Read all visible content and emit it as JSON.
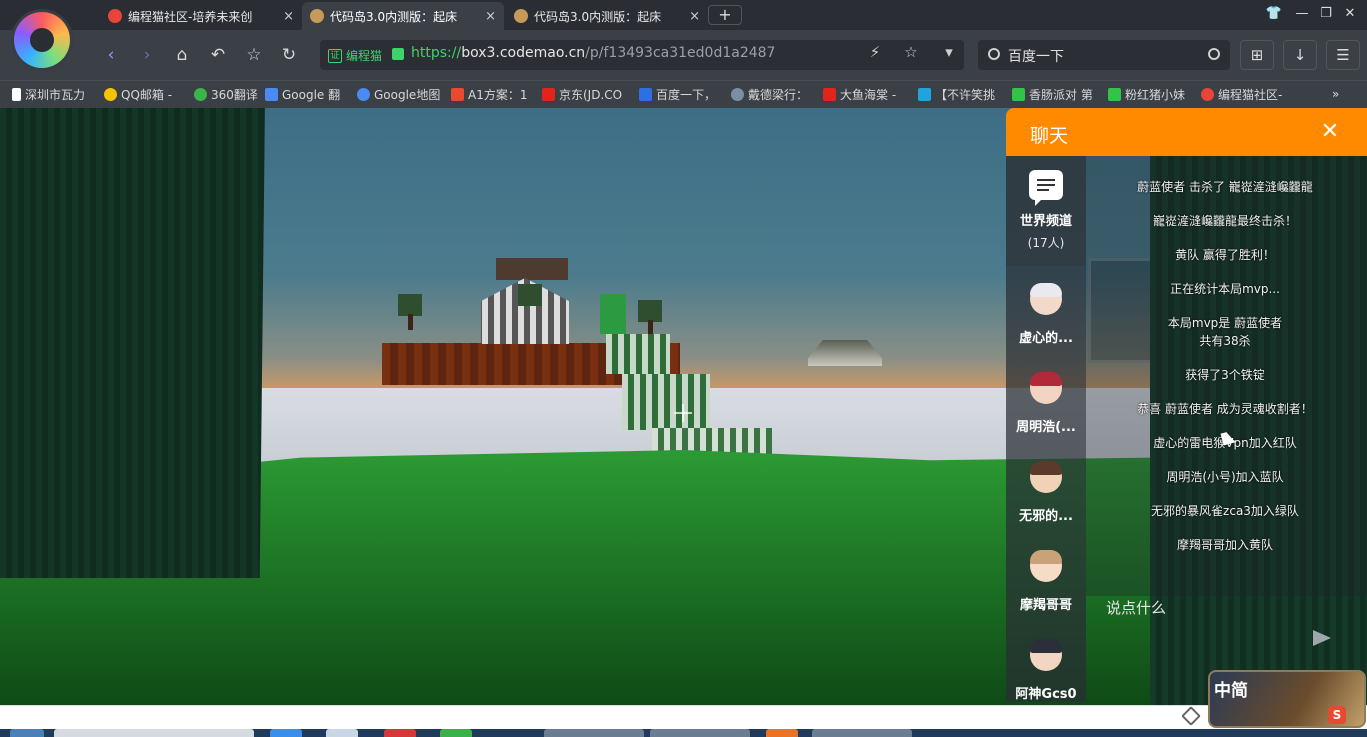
{
  "browser": {
    "tabs": [
      {
        "title": "编程猫社区-培养未来创",
        "close": "×",
        "active": false,
        "favicon_color": "#e8443a"
      },
      {
        "title": "代码岛3.0内测版：起床",
        "close": "×",
        "active": true,
        "favicon_color": "#c79a5a"
      },
      {
        "title": "代码岛3.0内测版：起床",
        "close": "×",
        "active": false,
        "favicon_color": "#c79a5a"
      }
    ],
    "new_tab": "+",
    "window_controls": [
      "👕",
      "—",
      "❐",
      "✕"
    ],
    "nav": {
      "back": "‹",
      "forward": "›",
      "home": "⌂",
      "undo": "↶",
      "star": "☆",
      "refresh": "↻"
    },
    "address": {
      "cert_name": "编程猫",
      "scheme": "https://",
      "host": "box3.codemao.cn",
      "path": "/p/f13493ca31ed0d1a2487"
    },
    "address_icons": {
      "flash": "⚡",
      "favorite": "☆",
      "dropdown": "▾"
    },
    "search": {
      "placeholder": "百度一下"
    },
    "right_buttons": [
      "⊞",
      "↓",
      "☰"
    ],
    "bookmarks": [
      {
        "label": "深圳市瓦力",
        "color": "#ffffff"
      },
      {
        "label": "QQ邮箱 -",
        "color": "#f7c300"
      },
      {
        "label": "360翻译",
        "color": "#3bb54a"
      },
      {
        "label": "Google 翻",
        "color": "#4a8af4"
      },
      {
        "label": "Google地图",
        "color": "#4a8af4"
      },
      {
        "label": "A1方案：1",
        "color": "#e84a2f"
      },
      {
        "label": "京东(JD.CO",
        "color": "#e1251b"
      },
      {
        "label": "百度一下，",
        "color": "#2f6fe4"
      },
      {
        "label": "戴德梁行：",
        "color": "#7a8fa6"
      },
      {
        "label": "大鱼海棠 -",
        "color": "#e1251b"
      },
      {
        "label": "【不许笑挑",
        "color": "#23a3dd"
      },
      {
        "label": "香肠派对 第",
        "color": "#33c24a"
      },
      {
        "label": "粉红猪小妹",
        "color": "#33c24a"
      },
      {
        "label": "编程猫社区-",
        "color": "#e8443a"
      }
    ],
    "bookmarks_more": "»"
  },
  "chat": {
    "title": "聊天",
    "close": "✕",
    "accent": "#ff8a00",
    "world_channel": {
      "label": "世界频道",
      "count": "(17人)"
    },
    "users": [
      {
        "name": "虚心的...",
        "skin": "#f3d9c9",
        "hair": "#e9e9ef"
      },
      {
        "name": "周明浩(...",
        "skin": "#f3d3c2",
        "hair": "#b02a3a"
      },
      {
        "name": "无邪的...",
        "skin": "#f1d2b6",
        "hair": "#5a3a2a"
      },
      {
        "name": "摩羯哥哥",
        "skin": "#f6dcc6",
        "hair": "#c9a27a"
      },
      {
        "name": "阿神Gcs0",
        "skin": "#f3d6c2",
        "hair": "#2a2f3a"
      }
    ],
    "messages": [
      "蔚蓝使者 击杀了 巃嵸滻漨巉龖龍",
      "巃嵸滻漨巉龖龍最终击杀！",
      "黄队 赢得了胜利！",
      "正在统计本局mvp...",
      "本局mvp是 蔚蓝使者\n共有38杀",
      "获得了3个铁锭",
      "恭喜 蔚蓝使者 成为灵魂收割者！",
      "虚心的雷电猴Vpn加入红队",
      "周明浩(小号)加入蓝队",
      "无邪的暴风雀zca3加入绿队",
      "摩羯哥哥加入黄队"
    ],
    "input_placeholder": "说点什么"
  },
  "ime": {
    "label": "中简",
    "s_icon": "S"
  }
}
